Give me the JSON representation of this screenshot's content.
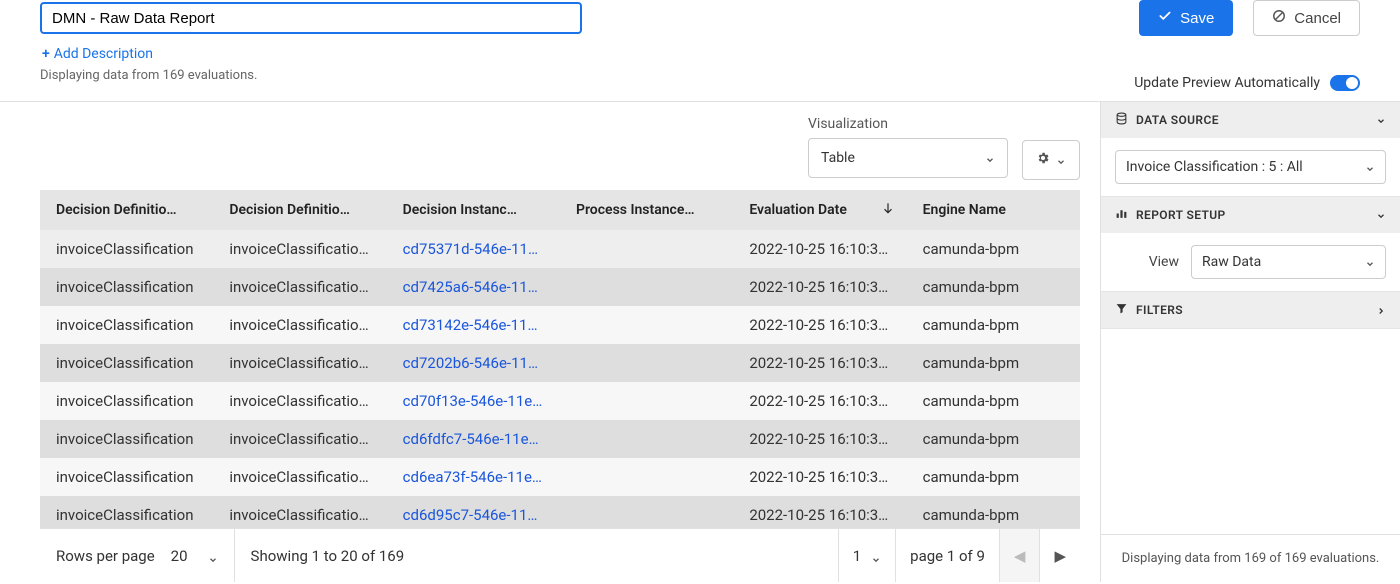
{
  "header": {
    "title_value": "DMN - Raw Data Report",
    "save_label": "Save",
    "cancel_label": "Cancel",
    "add_description": "Add Description",
    "evaluations_note": "Displaying data from 169 evaluations.",
    "update_preview_label": "Update Preview Automatically"
  },
  "visualization": {
    "label": "Visualization",
    "selected": "Table"
  },
  "table": {
    "columns": [
      "Decision Definitio…",
      "Decision Definitio…",
      "Decision Instanc…",
      "Process Instance…",
      "Evaluation Date",
      "Engine Name"
    ],
    "sorted_column_index": 4,
    "rows": [
      {
        "defKey": "invoiceClassification",
        "defId": "invoiceClassification:…",
        "instanceId": "cd75371d-546e-11e…",
        "processInstance": "",
        "evalDate": "2022-10-25 16:10:3…",
        "engine": "camunda-bpm"
      },
      {
        "defKey": "invoiceClassification",
        "defId": "invoiceClassification:…",
        "instanceId": "cd7425a6-546e-11e…",
        "processInstance": "",
        "evalDate": "2022-10-25 16:10:3…",
        "engine": "camunda-bpm"
      },
      {
        "defKey": "invoiceClassification",
        "defId": "invoiceClassification:…",
        "instanceId": "cd73142e-546e-11e…",
        "processInstance": "",
        "evalDate": "2022-10-25 16:10:3…",
        "engine": "camunda-bpm"
      },
      {
        "defKey": "invoiceClassification",
        "defId": "invoiceClassification:…",
        "instanceId": "cd7202b6-546e-11e…",
        "processInstance": "",
        "evalDate": "2022-10-25 16:10:3…",
        "engine": "camunda-bpm"
      },
      {
        "defKey": "invoiceClassification",
        "defId": "invoiceClassification:…",
        "instanceId": "cd70f13e-546e-11e…",
        "processInstance": "",
        "evalDate": "2022-10-25 16:10:3…",
        "engine": "camunda-bpm"
      },
      {
        "defKey": "invoiceClassification",
        "defId": "invoiceClassification:…",
        "instanceId": "cd6fdfc7-546e-11ed…",
        "processInstance": "",
        "evalDate": "2022-10-25 16:10:3…",
        "engine": "camunda-bpm"
      },
      {
        "defKey": "invoiceClassification",
        "defId": "invoiceClassification:…",
        "instanceId": "cd6ea73f-546e-11e…",
        "processInstance": "",
        "evalDate": "2022-10-25 16:10:3…",
        "engine": "camunda-bpm"
      },
      {
        "defKey": "invoiceClassification",
        "defId": "invoiceClassification:…",
        "instanceId": "cd6d95c7-546e-11e…",
        "processInstance": "",
        "evalDate": "2022-10-25 16:10:3…",
        "engine": "camunda-bpm"
      }
    ]
  },
  "pager": {
    "rows_per_page_label": "Rows per page",
    "rows_per_page_value": "20",
    "range_text": "Showing 1 to 20 of 169",
    "page_input": "1",
    "page_of_text": "page 1 of 9"
  },
  "sidepanel": {
    "data_source": {
      "title": "DATA SOURCE",
      "value": "Invoice Classification : 5 : All"
    },
    "report_setup": {
      "title": "REPORT SETUP",
      "view_label": "View",
      "view_value": "Raw Data"
    },
    "filters": {
      "title": "FILTERS"
    },
    "footer_text": "Displaying data from 169 of 169 evaluations."
  }
}
